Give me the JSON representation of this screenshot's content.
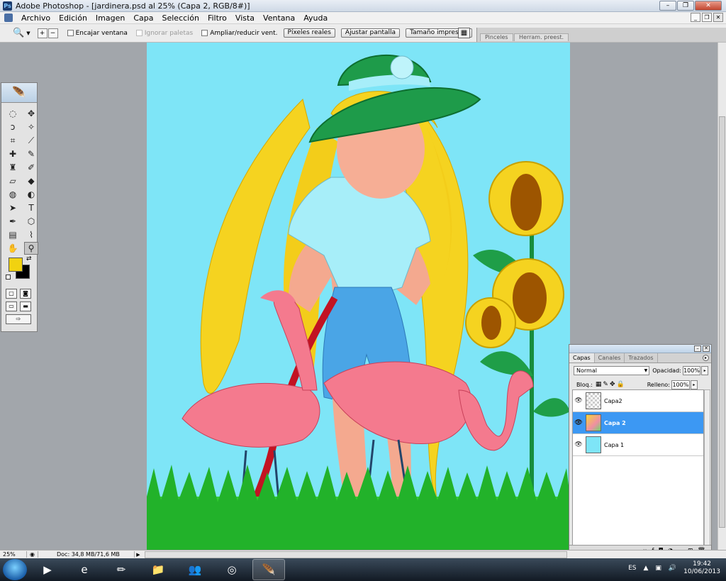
{
  "window": {
    "title": "Adobe Photoshop - [jardinera.psd al 25% (Capa 2, RGB/8#)]"
  },
  "menu": [
    "Archivo",
    "Edición",
    "Imagen",
    "Capa",
    "Selección",
    "Filtro",
    "Vista",
    "Ventana",
    "Ayuda"
  ],
  "options": {
    "chk_fit": "Encajar ventana",
    "chk_ignore": "Ignorar paletas",
    "chk_resize": "Ampliar/reducir vent.",
    "btn_actual": "Píxeles reales",
    "btn_fit": "Ajustar pantalla",
    "btn_print": "Tamaño impresión",
    "well_tab1": "Pinceles",
    "well_tab2": "Herram. preest."
  },
  "layers_panel": {
    "tabs": [
      "Capas",
      "Canales",
      "Trazados"
    ],
    "blend_mode": "Normal",
    "opacity_label": "Opacidad:",
    "opacity_value": "100%",
    "lock_label": "Bloq.:",
    "fill_label": "Relleno:",
    "fill_value": "100%",
    "layers": [
      {
        "name": "Capa2",
        "selected": false
      },
      {
        "name": "Capa 2",
        "selected": true
      },
      {
        "name": "Capa 1",
        "selected": false
      }
    ]
  },
  "status": {
    "zoom": "25%",
    "doc": "Doc: 34,8 MB/71,6 MB"
  },
  "taskbar": {
    "lang": "ES",
    "time": "19:42",
    "date": "10/06/2013"
  },
  "colors": {
    "foreground": "#f1d210",
    "background": "#000000",
    "canvas": "#7ee5f7",
    "selection": "#3c98f3"
  },
  "icons": {
    "tools": [
      "marquee-icon",
      "move-icon",
      "lasso-icon",
      "magic-wand-icon",
      "crop-icon",
      "slice-icon",
      "healing-icon",
      "brush-icon",
      "clone-stamp-icon",
      "history-brush-icon",
      "eraser-icon",
      "paint-bucket-icon",
      "blur-icon",
      "dodge-icon",
      "path-select-icon",
      "type-icon",
      "pen-icon",
      "shape-icon",
      "notes-icon",
      "eyedropper-icon",
      "hand-icon",
      "zoom-icon"
    ]
  }
}
